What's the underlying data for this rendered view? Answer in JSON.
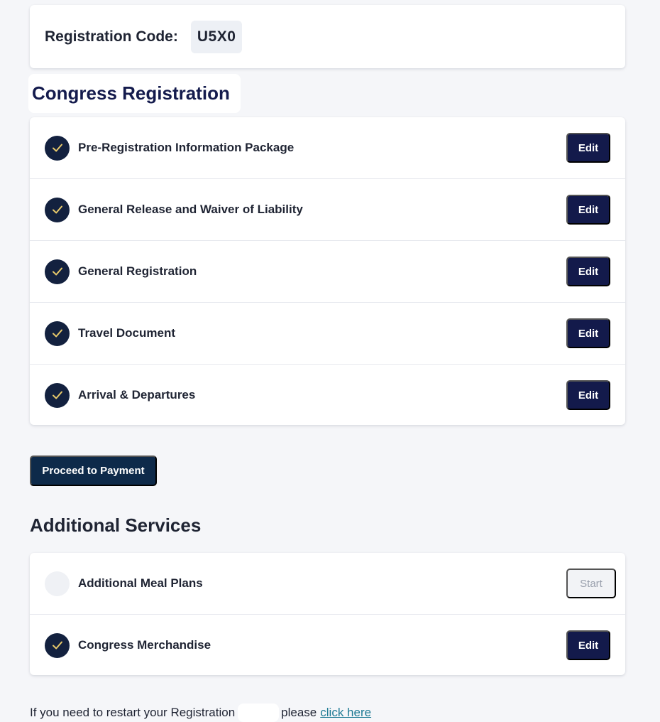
{
  "registration": {
    "label": "Registration Code:",
    "code": "U5X0"
  },
  "congress": {
    "title": "Congress Registration",
    "steps": [
      {
        "label": "Pre-Registration Information Package",
        "status": "complete",
        "action": "Edit"
      },
      {
        "label": "General Release and Waiver of Liability",
        "status": "complete",
        "action": "Edit"
      },
      {
        "label": "General Registration",
        "status": "complete",
        "action": "Edit"
      },
      {
        "label": "Travel Document",
        "status": "complete",
        "action": "Edit"
      },
      {
        "label": "Arrival & Departures",
        "status": "complete",
        "action": "Edit"
      }
    ]
  },
  "payment": {
    "button_label": "Proceed to Payment"
  },
  "services": {
    "title": "Additional Services",
    "items": [
      {
        "label": "Additional Meal Plans",
        "status": "not-started",
        "action": "Start"
      },
      {
        "label": "Congress Merchandise",
        "status": "complete",
        "action": "Edit"
      }
    ]
  },
  "restart": {
    "text_before": "If you need to restart your Registration",
    "text_after": "please",
    "link_label": "click here"
  },
  "colors": {
    "primary_navy": "#131a4b",
    "check_circle": "#13213f",
    "check_mark": "#e8c96a",
    "link": "#1e7a94"
  },
  "icons": {
    "complete": "check-icon",
    "incomplete": "empty-circle-icon"
  }
}
